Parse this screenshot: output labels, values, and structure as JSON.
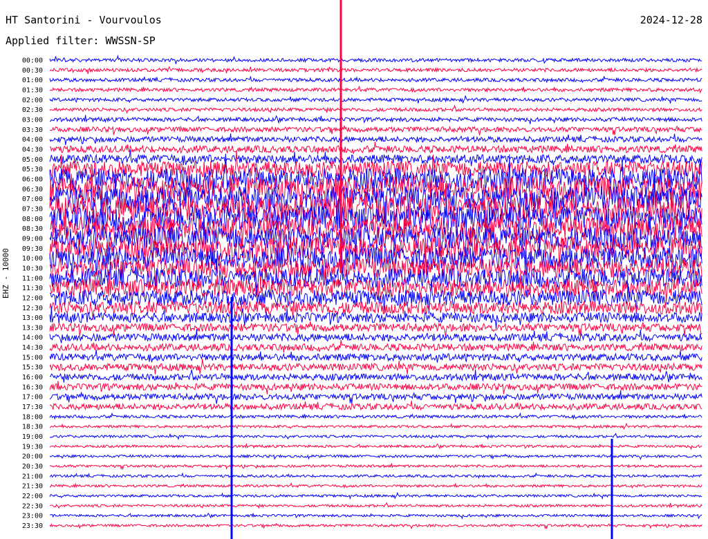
{
  "header": {
    "station": "HT Santorini - Vourvoulos",
    "date": "2024-12-28",
    "filter": "Applied filter: WWSSN-SP"
  },
  "chart_data": {
    "type": "line",
    "title": "HT Santorini - Vourvoulos",
    "ylabel": "EHZ - 10000",
    "xlabel": "",
    "colors": [
      "#0000ff",
      "#ff0040"
    ],
    "y_ticks": [
      "00:00",
      "00:30",
      "01:00",
      "01:30",
      "02:00",
      "02:30",
      "03:00",
      "03:30",
      "04:00",
      "04:30",
      "05:00",
      "05:30",
      "06:00",
      "06:30",
      "07:00",
      "07:30",
      "08:00",
      "08:30",
      "09:00",
      "09:30",
      "10:00",
      "10:30",
      "11:00",
      "11:30",
      "12:00",
      "12:30",
      "13:00",
      "13:30",
      "14:00",
      "14:30",
      "15:00",
      "15:30",
      "16:00",
      "16:30",
      "17:00",
      "17:30",
      "18:00",
      "18:30",
      "19:00",
      "19:30",
      "20:00",
      "20:30",
      "21:00",
      "21:30",
      "22:00",
      "22:30",
      "23:00",
      "23:30"
    ],
    "trace_amplitude": [
      0.35,
      0.35,
      0.35,
      0.35,
      0.35,
      0.35,
      0.4,
      0.5,
      0.55,
      0.7,
      0.9,
      1.6,
      2.2,
      2.4,
      2.5,
      2.5,
      2.5,
      2.4,
      2.4,
      2.3,
      2.2,
      2.0,
      1.9,
      1.8,
      1.6,
      1.3,
      1.0,
      0.8,
      0.75,
      0.7,
      0.7,
      0.7,
      0.65,
      0.65,
      0.6,
      0.6,
      0.3,
      0.25,
      0.25,
      0.25,
      0.25,
      0.25,
      0.25,
      0.25,
      0.25,
      0.25,
      0.25,
      0.25
    ]
  }
}
